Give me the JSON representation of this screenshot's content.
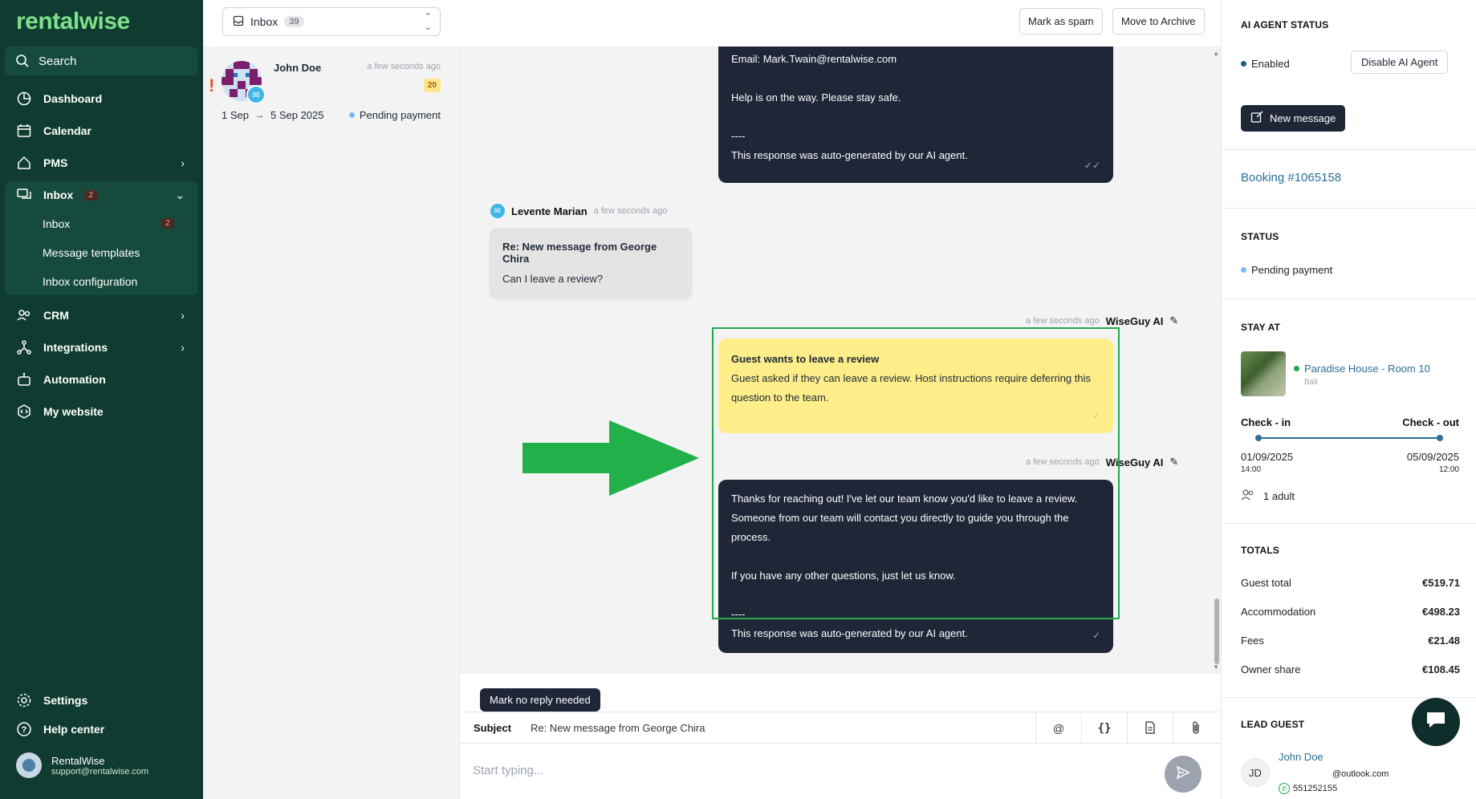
{
  "sidebar": {
    "logo": "rentalwise",
    "search_label": "Search",
    "items": [
      {
        "label": "Dashboard"
      },
      {
        "label": "Calendar"
      },
      {
        "label": "PMS"
      },
      {
        "label": "Inbox",
        "badge": "2"
      },
      {
        "label": "CRM"
      },
      {
        "label": "Integrations"
      },
      {
        "label": "Automation"
      },
      {
        "label": "My website"
      }
    ],
    "inbox_sub": [
      {
        "label": "Inbox",
        "badge": "2"
      },
      {
        "label": "Message templates"
      },
      {
        "label": "Inbox configuration"
      }
    ],
    "bottom": [
      {
        "label": "Settings"
      },
      {
        "label": "Help center"
      }
    ],
    "user": {
      "name": "RentalWise",
      "email": "support@rentalwise.com"
    }
  },
  "list": {
    "inbox_label": "Inbox",
    "inbox_count": "39",
    "conversation": {
      "name": "John Doe",
      "time": "a few seconds ago",
      "score": "20",
      "date_from": "1 Sep",
      "date_to": "5 Sep 2025",
      "status": "Pending payment",
      "status_color": "#7ab8f5"
    }
  },
  "toolbar": {
    "spam_label": "Mark as spam",
    "archive_label": "Move to Archive"
  },
  "thread": {
    "msg1": {
      "line1": "Email: Mark.Twain@rentalwise.com",
      "line2": "Help is on the way. Please stay safe.",
      "line3": "----",
      "line4": "This response was auto-generated by our AI agent."
    },
    "msg2": {
      "sender": "Levente Marian",
      "time": "a few seconds ago",
      "subject": "Re: New message from George Chira",
      "body": "Can I leave a review?"
    },
    "msg3": {
      "time": "a few seconds ago",
      "sender": "WiseGuy AI",
      "title": "Guest wants to leave a review",
      "body": "Guest asked if they can leave a review. Host instructions require deferring this question to the team."
    },
    "msg4": {
      "time": "a few seconds ago",
      "sender": "WiseGuy AI",
      "line1": "Thanks for reaching out! I've let our team know you'd like to leave a review. Someone from our team will contact you directly to guide you through the process.",
      "line2": "If you have any other questions, just let us know.",
      "line3": "----",
      "line4": "This response was auto-generated by our AI agent."
    },
    "no_reply_label": "Mark no reply needed"
  },
  "composer": {
    "subject_label": "Subject",
    "subject_value": "Re: New message from George Chira",
    "placeholder": "Start typing..."
  },
  "right": {
    "ai_status_title": "AI AGENT STATUS",
    "ai_status_value": "Enabled",
    "ai_status_color": "#1f5f8b",
    "disable_label": "Disable AI Agent",
    "new_message_label": "New message",
    "booking_label": "Booking #1065158",
    "status_title": "STATUS",
    "status_value": "Pending payment",
    "stay_title": "STAY AT",
    "property_name": "Paradise House - Room 10",
    "property_location": "Bali",
    "checkin_label": "Check - in",
    "checkout_label": "Check - out",
    "checkin_date": "01/09/2025",
    "checkin_time": "14:00",
    "checkout_date": "05/09/2025",
    "checkout_time": "12:00",
    "guests": "1 adult",
    "totals_title": "TOTALS",
    "totals": [
      {
        "label": "Guest total",
        "value": "€519.71"
      },
      {
        "label": "Accommodation",
        "value": "€498.23"
      },
      {
        "label": "Fees",
        "value": "€21.48"
      },
      {
        "label": "Owner share",
        "value": "€108.45"
      }
    ],
    "lead_title": "LEAD GUEST",
    "lead_initials": "JD",
    "lead_name": "John Doe",
    "lead_email": "@outlook.com",
    "lead_phone": "551252155"
  }
}
